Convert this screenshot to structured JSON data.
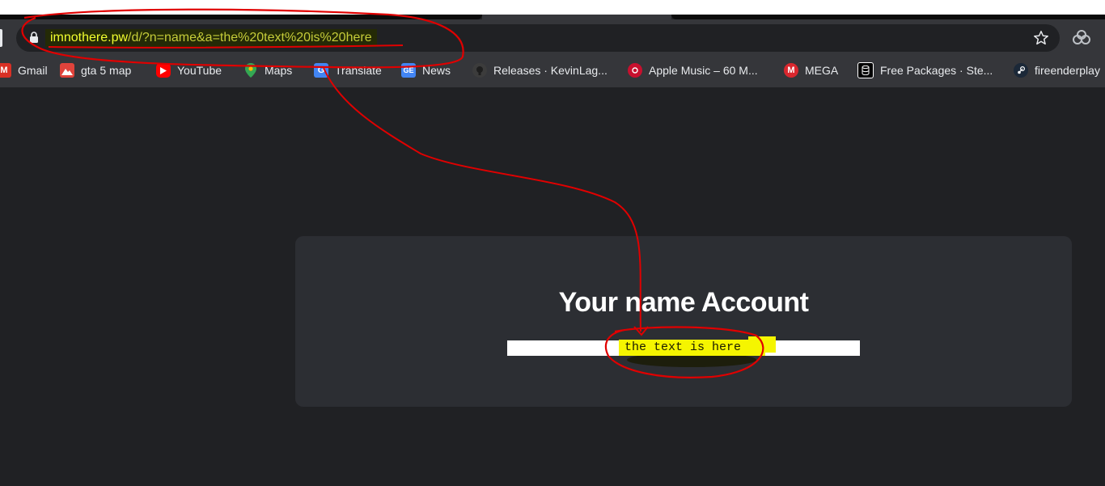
{
  "browser": {
    "url": {
      "host": "imnothere.pw",
      "path": "/d/?n=name&a=the%20text%20is%20here"
    }
  },
  "bookmarks": [
    {
      "label": "Gmail",
      "icon": "gmail-icon"
    },
    {
      "label": "gta 5 map",
      "icon": "map-image-icon"
    },
    {
      "label": "YouTube",
      "icon": "youtube-icon"
    },
    {
      "label": "Maps",
      "icon": "maps-pin-icon"
    },
    {
      "label": "Translate",
      "icon": "translate-icon"
    },
    {
      "label": "News",
      "icon": "news-icon"
    },
    {
      "label": "Releases · KevinLag...",
      "icon": "github-icon"
    },
    {
      "label": "Apple Music – 60 M...",
      "icon": "apple-music-icon"
    },
    {
      "label": "MEGA",
      "icon": "mega-icon"
    },
    {
      "label": "Free Packages · Ste...",
      "icon": "database-icon"
    },
    {
      "label": "fireenderplay",
      "icon": "steam-icon"
    }
  ],
  "page": {
    "title": "Your name Account",
    "field_value": "the text is here"
  },
  "colors": {
    "background": "#202124",
    "card": "#2c2e33",
    "highlight": "#f5f500",
    "annotation": "#e00000"
  }
}
